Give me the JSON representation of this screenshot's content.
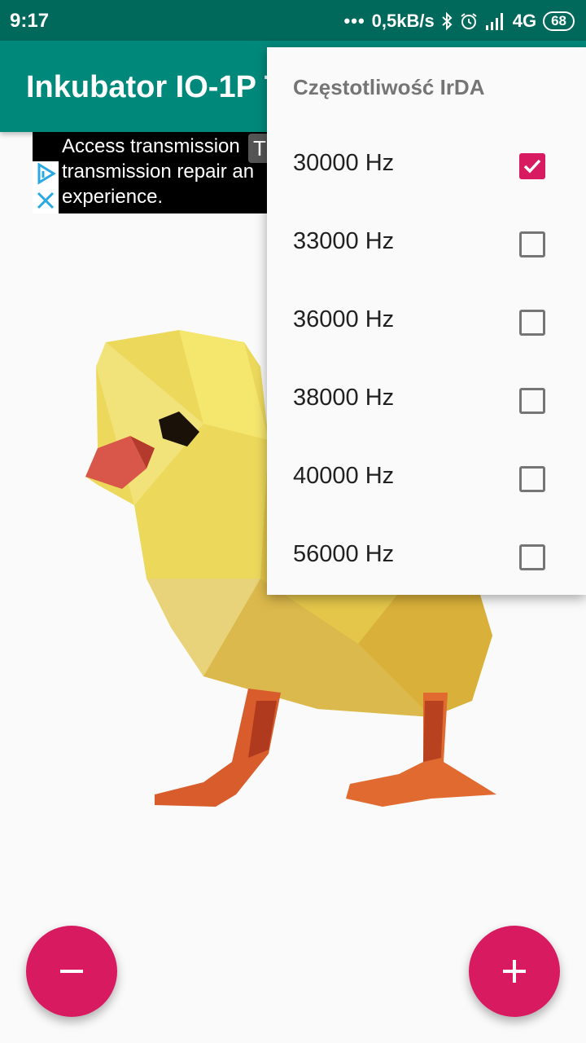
{
  "status_bar": {
    "time": "9:17",
    "network_speed": "0,5kB/s",
    "network_type": "4G",
    "battery": "68",
    "icons": [
      "bluetooth-icon",
      "alarm-icon",
      "signal-icon"
    ]
  },
  "app_bar": {
    "title": "Inkubator IO-1P Te"
  },
  "ad": {
    "lines": [
      "Access transmission",
      "transmission repair an",
      "experience."
    ],
    "badge": "T"
  },
  "menu": {
    "title": "Częstotliwość IrDA",
    "items": [
      {
        "label": "30000 Hz",
        "checked": true
      },
      {
        "label": "33000 Hz",
        "checked": false
      },
      {
        "label": "36000 Hz",
        "checked": false
      },
      {
        "label": "38000 Hz",
        "checked": false
      },
      {
        "label": "40000 Hz",
        "checked": false
      },
      {
        "label": "56000 Hz",
        "checked": false
      }
    ]
  },
  "fabs": {
    "minus": "minus-icon",
    "plus": "plus-icon"
  },
  "colors": {
    "status_bar": "#00695c",
    "app_bar": "#00897b",
    "accent": "#d81b60"
  }
}
